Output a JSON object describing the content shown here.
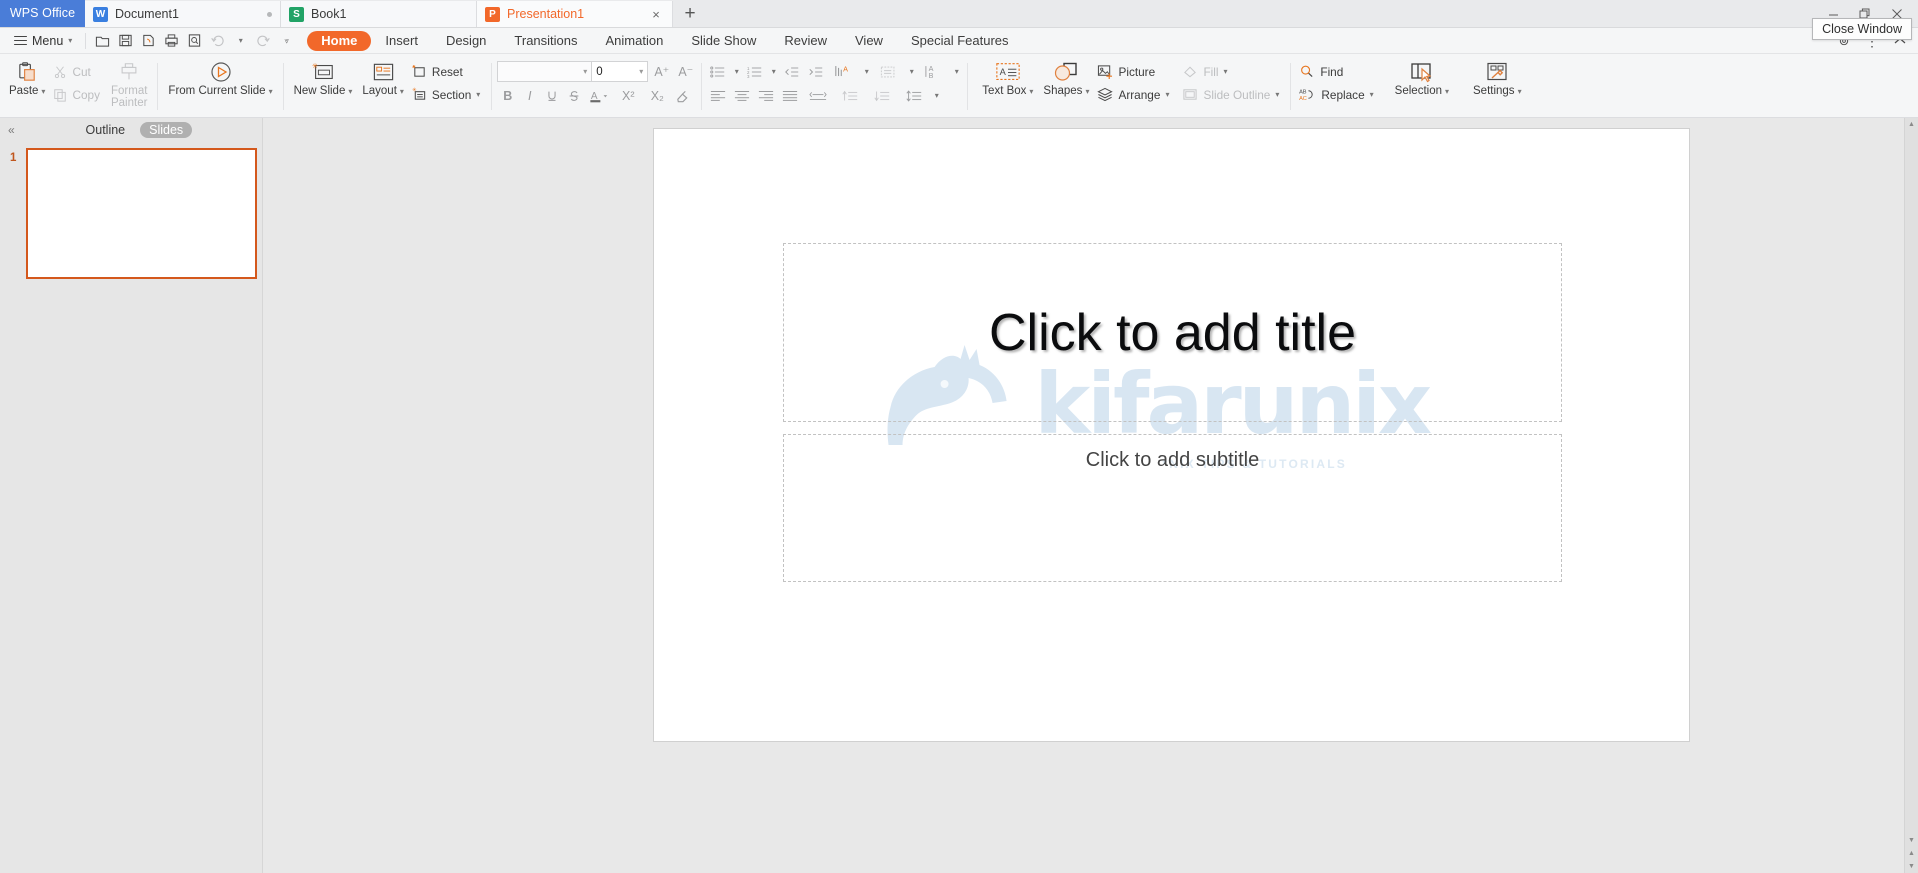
{
  "app": {
    "brand": "WPS Office"
  },
  "tabs": [
    {
      "label": "Document1",
      "icon": "word-doc-icon",
      "type": "w",
      "active": false
    },
    {
      "label": "Book1",
      "icon": "spreadsheet-icon",
      "type": "s",
      "active": false
    },
    {
      "label": "Presentation1",
      "icon": "presentation-icon",
      "type": "p",
      "active": true
    }
  ],
  "tab_controls": {
    "new_tab": "+",
    "close_tab": "×"
  },
  "window": {
    "minimize": "—",
    "restore": "❐",
    "close": "✕",
    "tooltip": "Close Window"
  },
  "menubar": {
    "menu_label": "Menu",
    "quick_access": [
      "new-icon",
      "save-icon",
      "print-preview-icon",
      "print-icon",
      "find-icon",
      "undo-icon",
      "redo-icon",
      "customize-icon"
    ],
    "ribbon_tabs": [
      {
        "label": "Home",
        "active": true
      },
      {
        "label": "Insert",
        "active": false
      },
      {
        "label": "Design",
        "active": false
      },
      {
        "label": "Transitions",
        "active": false
      },
      {
        "label": "Animation",
        "active": false
      },
      {
        "label": "Slide Show",
        "active": false
      },
      {
        "label": "Review",
        "active": false
      },
      {
        "label": "View",
        "active": false
      },
      {
        "label": "Special Features",
        "active": false
      }
    ],
    "right_icons": [
      "help-icon",
      "more-options-icon",
      "collapse-ribbon-icon"
    ]
  },
  "toolbar": {
    "paste": "Paste",
    "cut": "Cut",
    "copy": "Copy",
    "format_painter_line1": "Format",
    "format_painter_line2": "Painter",
    "from_current_slide": "From Current Slide",
    "new_slide": "New Slide",
    "layout": "Layout",
    "reset": "Reset",
    "section": "Section",
    "font_name": "",
    "font_name_placeholder": "",
    "font_size": "0",
    "grow_font": "A⁺",
    "shrink_font": "A⁻",
    "bold": "B",
    "italic": "I",
    "underline": "U",
    "strikethrough": "S",
    "font_color": "A",
    "superscript": "X²",
    "subscript": "X₂",
    "clear_format": "clear-formatting-icon",
    "text_box": "Text Box",
    "shapes": "Shapes",
    "picture": "Picture",
    "arrange": "Arrange",
    "fill": "Fill",
    "slide_outline": "Slide Outline",
    "find": "Find",
    "replace": "Replace",
    "selection": "Selection",
    "settings": "Settings"
  },
  "side_panel": {
    "collapse": "«",
    "tabs": [
      {
        "label": "Outline",
        "active": false
      },
      {
        "label": "Slides",
        "active": true
      }
    ],
    "slides": [
      {
        "number": "1"
      }
    ]
  },
  "slide": {
    "title_placeholder": "Click to add title",
    "subtitle_placeholder": "Click to add subtitle",
    "watermark_text": "kifarunix",
    "watermark_tagline": "*NIX TIPS & TUTORIALS"
  },
  "colors": {
    "accent": "#f2682a",
    "brand_blue": "#4a7dd8",
    "watermark": "#d8e6f2",
    "slide_border": "#d4581c"
  }
}
